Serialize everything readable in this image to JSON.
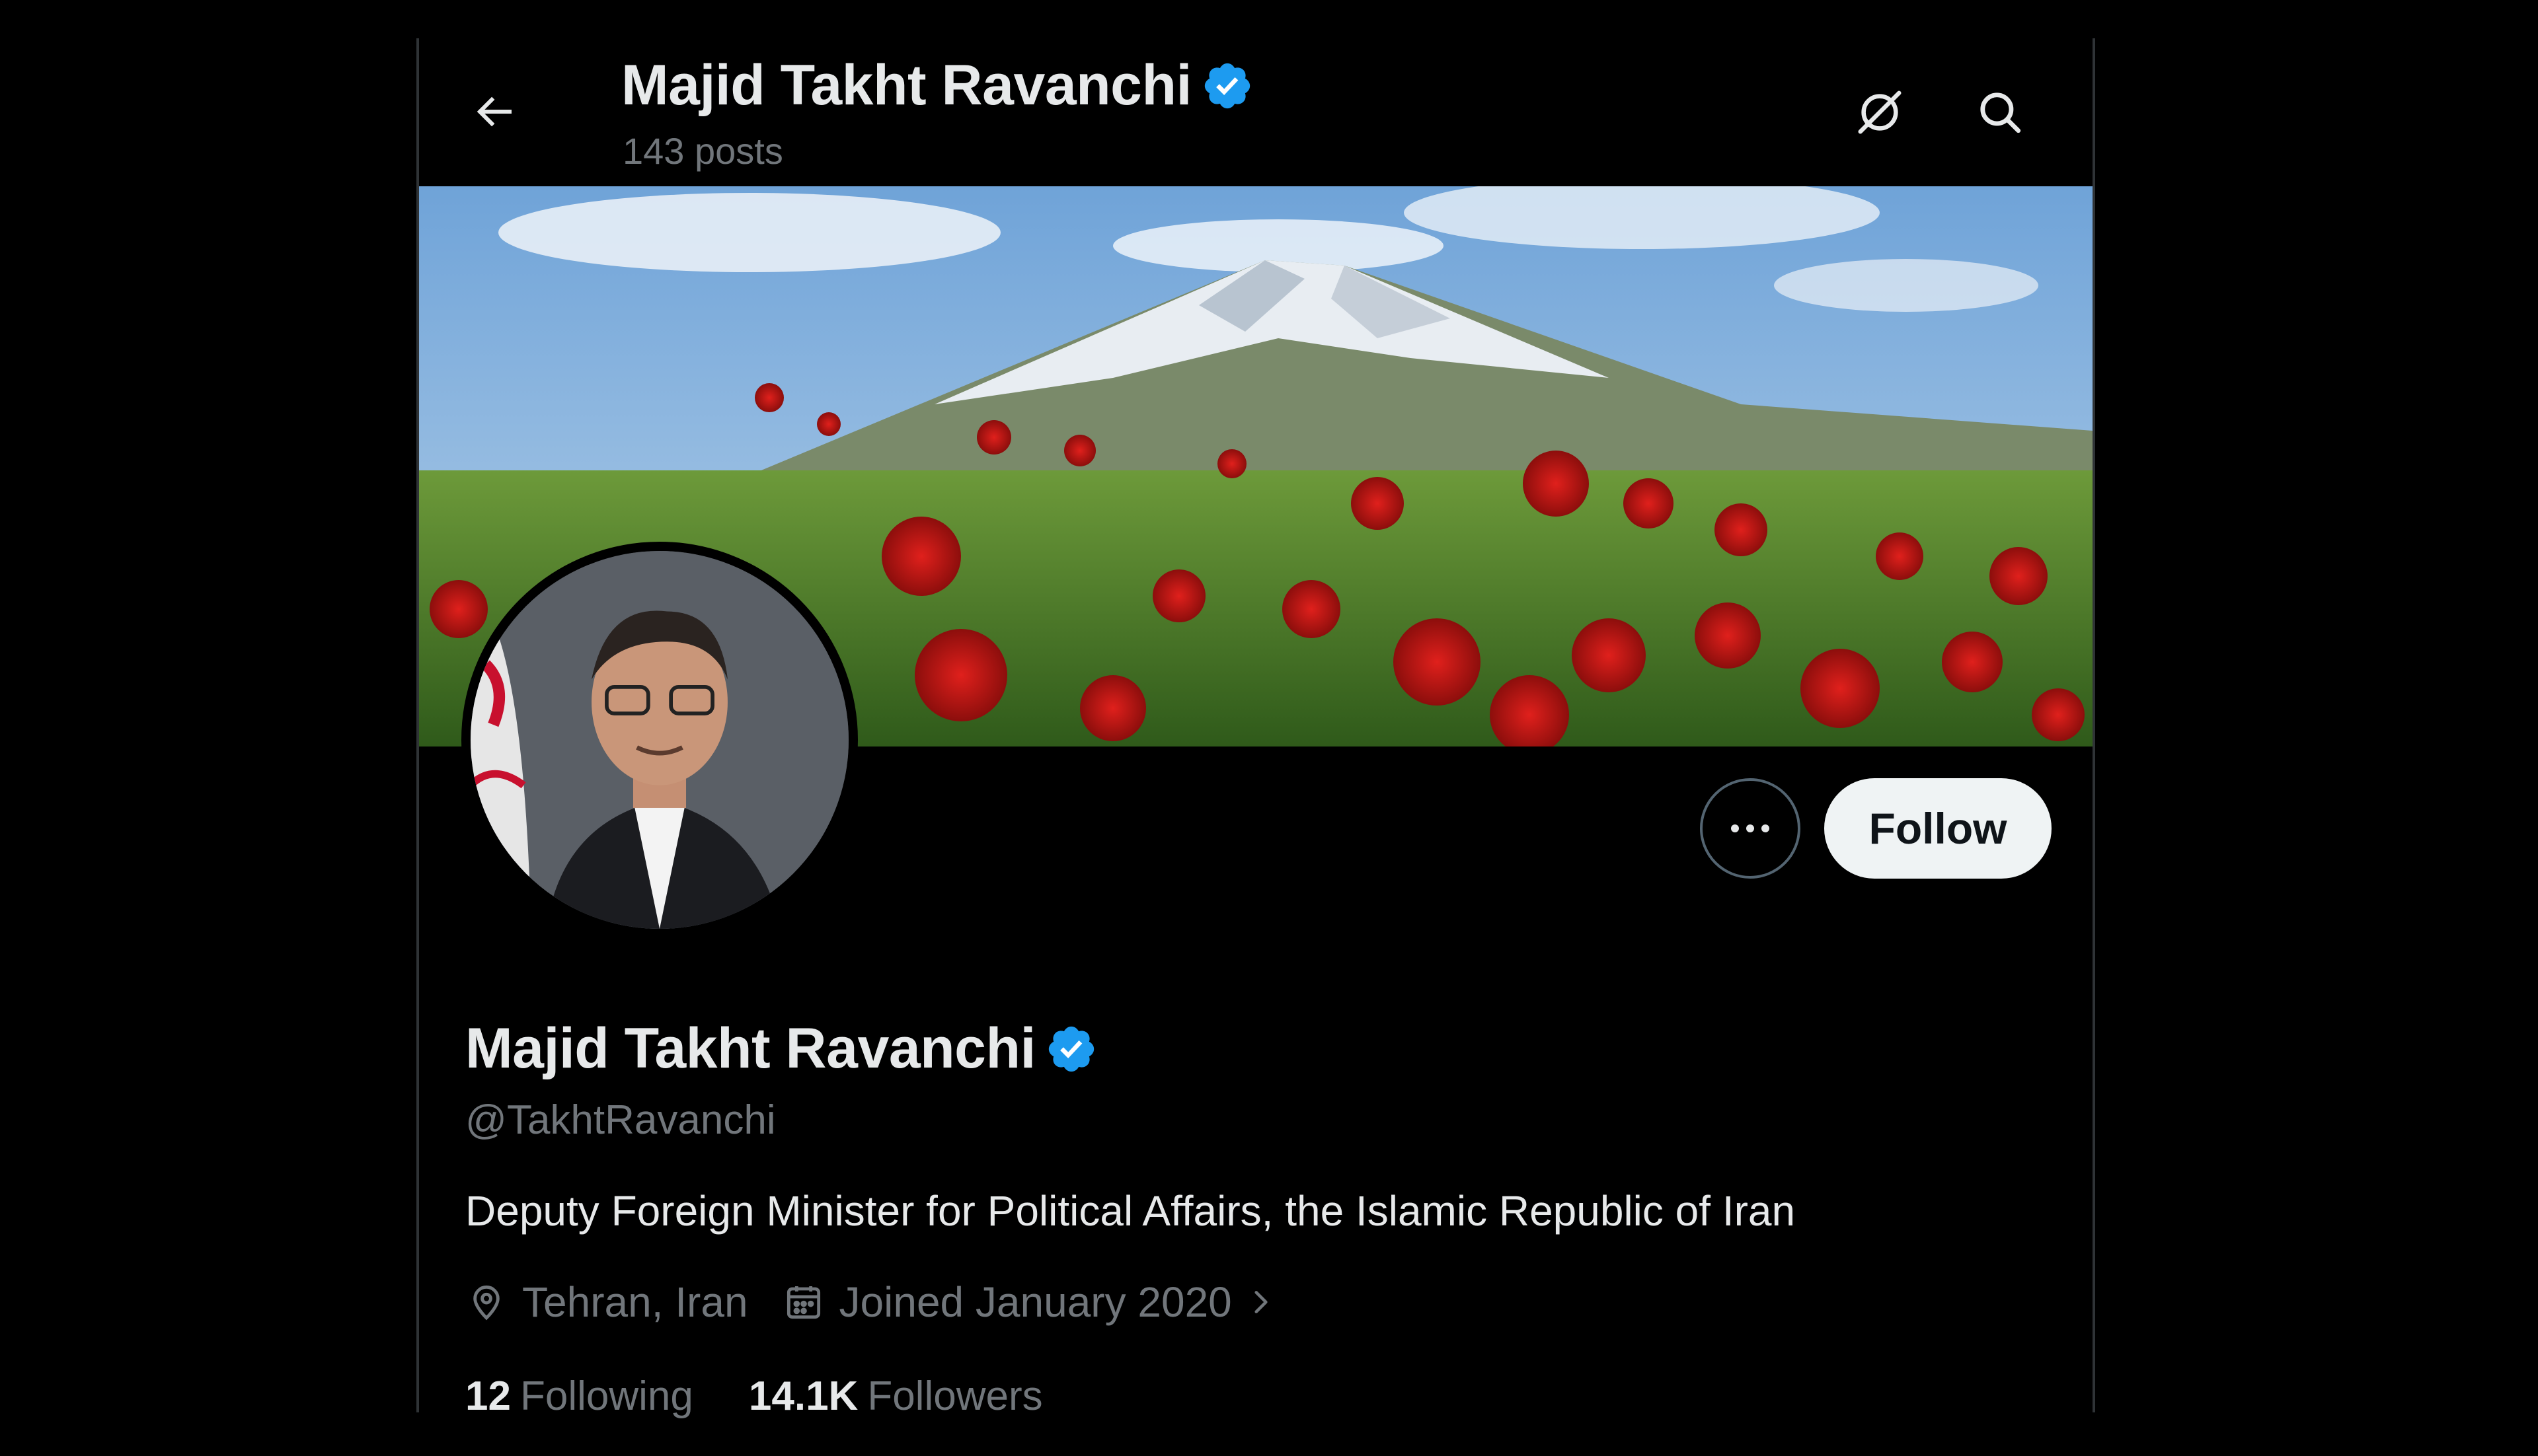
{
  "header": {
    "title": "Majid Takht Ravanchi",
    "posts_count": "143 posts"
  },
  "profile": {
    "display_name": "Majid Takht Ravanchi",
    "handle": "@TakhtRavanchi",
    "bio": "Deputy Foreign Minister for Political Affairs, the Islamic Republic of Iran",
    "location": "Tehran, Iran",
    "joined": "Joined January 2020",
    "following_count": "12",
    "following_label": "Following",
    "followers_count": "14.1K",
    "followers_label": "Followers",
    "verified": true
  },
  "actions": {
    "follow_label": "Follow"
  },
  "icons": {
    "back": "arrow-left-icon",
    "grok": "grok-icon",
    "search": "search-icon",
    "more": "more-icon",
    "verified": "verified-badge-icon",
    "location": "location-pin-icon",
    "calendar": "calendar-icon",
    "chevron": "chevron-right-icon"
  },
  "colors": {
    "background": "#000000",
    "text_primary": "#e7e9ea",
    "text_secondary": "#71767b",
    "verified_blue": "#1d9bf0",
    "follow_bg": "#eff3f4"
  }
}
